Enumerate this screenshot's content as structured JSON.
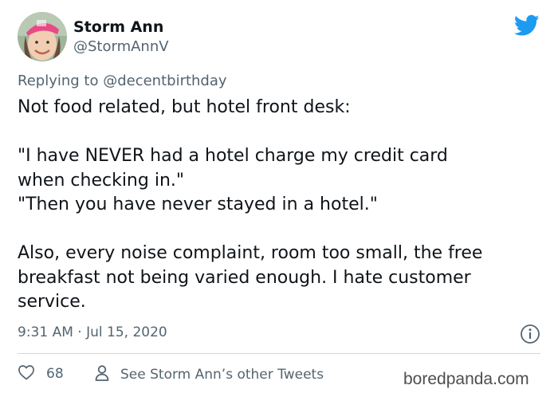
{
  "author": {
    "name": "Storm Ann",
    "handle": "@StormAnnV"
  },
  "reply": {
    "prefix": "Replying to ",
    "mention": "@decentbirthday"
  },
  "tweet": {
    "lines": [
      "Not food related, but hotel front desk:",
      "",
      "\"I have NEVER had a hotel charge my credit card",
      "when checking in.\"",
      "\"Then you have never stayed in a hotel.\"",
      "",
      "Also, every noise complaint, room too small, the free",
      "breakfast not being varied enough. I hate customer",
      "service."
    ]
  },
  "meta": {
    "timestamp": "9:31 AM · Jul 15, 2020"
  },
  "actions": {
    "likes": "68",
    "other_tweets": "See Storm Ann’s other Tweets"
  },
  "watermark": "boredpanda.com",
  "colors": {
    "brand_blue": "#1d9bf0",
    "secondary_text": "#536471"
  },
  "icons": [
    "twitter-bird-icon",
    "info-icon",
    "heart-icon",
    "person-icon"
  ]
}
